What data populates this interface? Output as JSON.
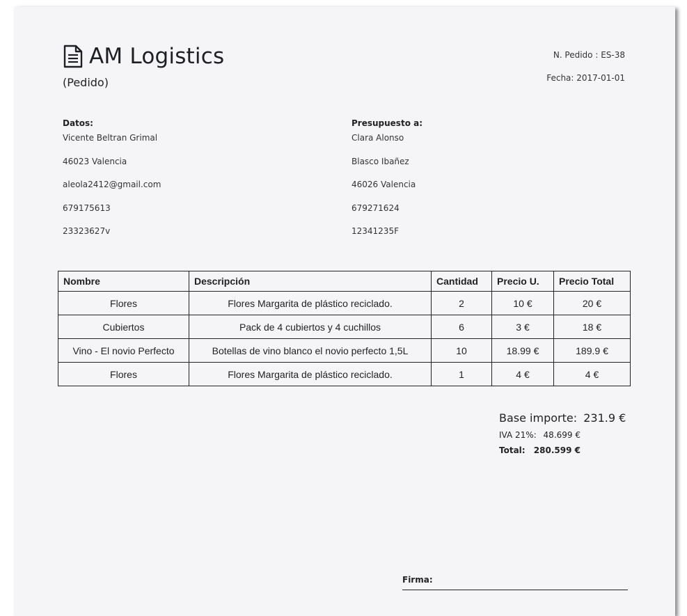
{
  "header": {
    "title": "AM Logistics",
    "subtitle": "(Pedido)",
    "order_label": "N. Pedido : ES-38",
    "date_label": "Fecha: 2017-01-01",
    "icon": "document-icon"
  },
  "sender": {
    "heading": "Datos:",
    "lines": [
      "Vicente Beltran Grimal",
      "46023 Valencia",
      "aleola2412@gmail.com",
      "679175613",
      "23323627v"
    ]
  },
  "recipient": {
    "heading": "Presupuesto a:",
    "lines": [
      "Clara Alonso",
      "Blasco Ibañez",
      "46026 Valencia",
      "679271624",
      "12341235F"
    ]
  },
  "table": {
    "headers": [
      "Nombre",
      "Descripción",
      "Cantidad",
      "Precio U.",
      "Precio Total"
    ],
    "rows": [
      [
        "Flores",
        "Flores Margarita de plástico reciclado.",
        "2",
        "10 €",
        "20 €"
      ],
      [
        "Cubiertos",
        "Pack de 4 cubiertos y 4 cuchillos",
        "6",
        "3 €",
        "18 €"
      ],
      [
        "Vino - El novio Perfecto",
        "Botellas de vino blanco el novio perfecto 1,5L",
        "10",
        "18.99 €",
        "189.9 €"
      ],
      [
        "Flores",
        "Flores Margarita de plástico reciclado.",
        "1",
        "4 €",
        "4 €"
      ]
    ]
  },
  "totals": {
    "base_label": "Base importe:",
    "base_value": "231.9 €",
    "iva_label": "IVA 21%:",
    "iva_value": "48.699 €",
    "total_label": "Total:",
    "total_value": "280.599 €"
  },
  "signature": {
    "label": "Firma:"
  }
}
